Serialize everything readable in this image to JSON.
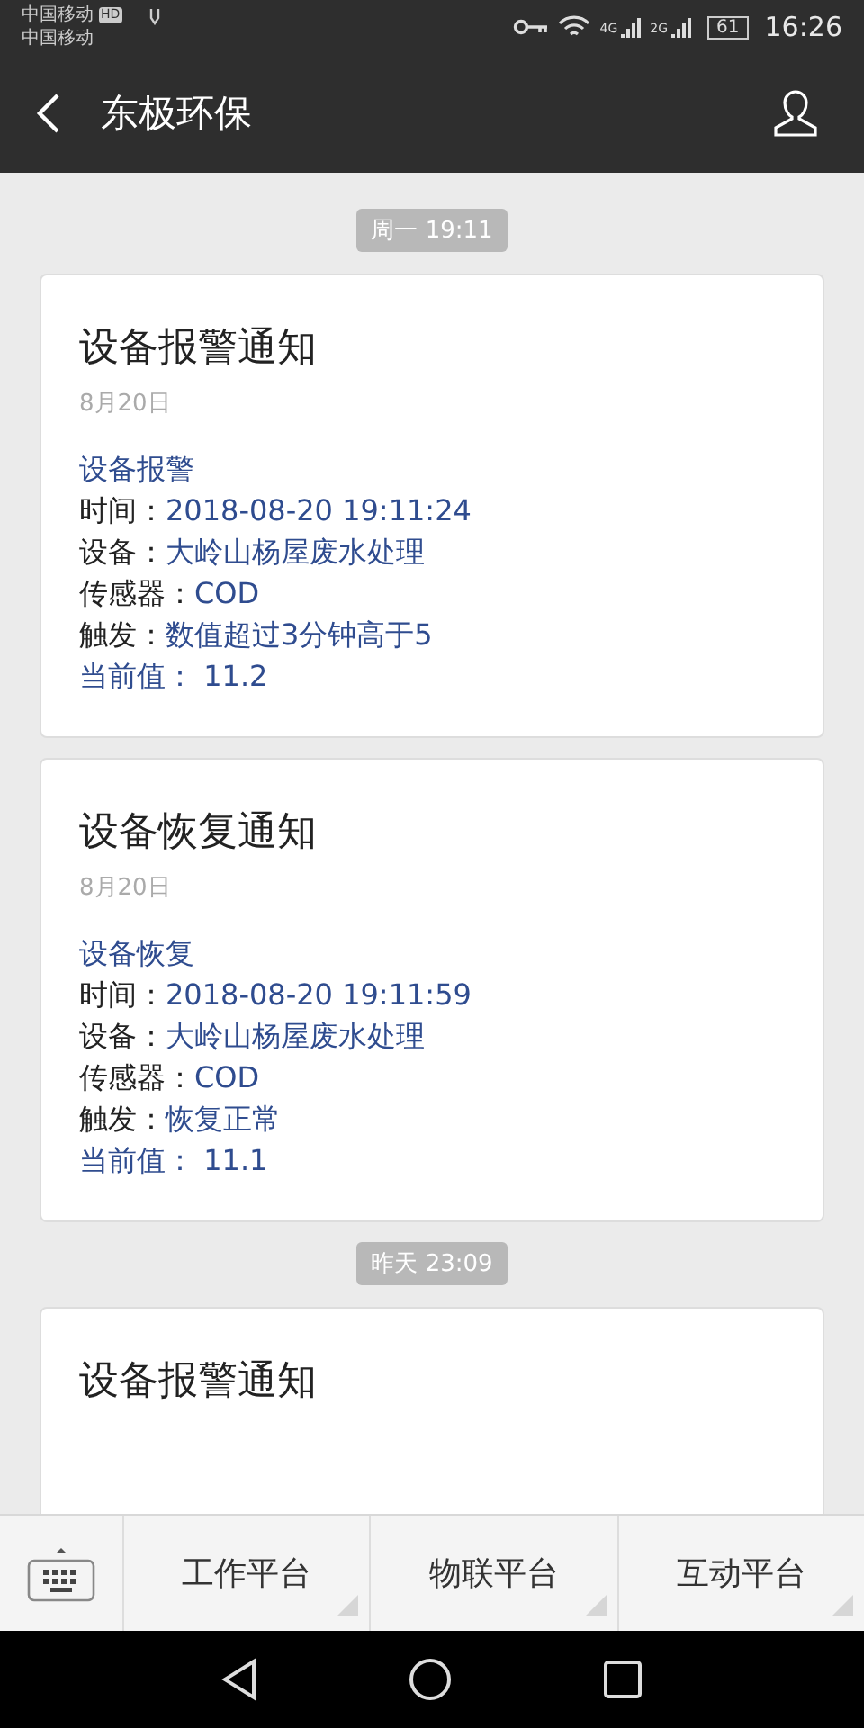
{
  "status_bar": {
    "carrier_1": "中国移动",
    "hd_badge": "HD",
    "carrier_2": "中国移动",
    "network_1": "4G",
    "network_2": "2G",
    "battery": "61",
    "time": "16:26"
  },
  "header": {
    "title": "东极环保"
  },
  "messages": [
    {
      "kind": "timestamp",
      "text": "周一 19:11"
    },
    {
      "kind": "card",
      "title": "设备报警通知",
      "date": "8月20日",
      "lines": [
        {
          "kind": "heading",
          "text": "设备报警"
        },
        {
          "kind": "field",
          "label": "时间：",
          "value": "2018-08-20 19:11:24"
        },
        {
          "kind": "field",
          "label": "设备：",
          "value": "大岭山杨屋废水处理"
        },
        {
          "kind": "field",
          "label": "传感器：",
          "value": "COD"
        },
        {
          "kind": "field",
          "label": "触发：",
          "value": "数值超过3分钟高于5"
        },
        {
          "kind": "current",
          "label": "当前值：",
          "value": " 11.2"
        }
      ]
    },
    {
      "kind": "card",
      "title": "设备恢复通知",
      "date": "8月20日",
      "lines": [
        {
          "kind": "heading",
          "text": "设备恢复"
        },
        {
          "kind": "field",
          "label": "时间：",
          "value": "2018-08-20 19:11:59"
        },
        {
          "kind": "field",
          "label": "设备：",
          "value": "大岭山杨屋废水处理"
        },
        {
          "kind": "field",
          "label": "传感器：",
          "value": "COD"
        },
        {
          "kind": "field",
          "label": "触发：",
          "value": "恢复正常"
        },
        {
          "kind": "current",
          "label": "当前值：",
          "value": " 11.1"
        }
      ]
    },
    {
      "kind": "timestamp",
      "text": "昨天 23:09"
    },
    {
      "kind": "card",
      "title": "设备报警通知"
    }
  ],
  "menu": [
    "工作平台",
    "物联平台",
    "互动平台"
  ]
}
